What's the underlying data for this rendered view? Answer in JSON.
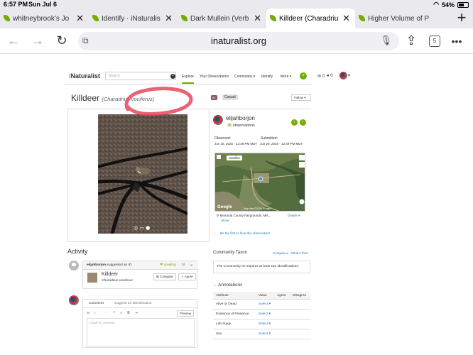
{
  "status": {
    "time": "6:57 PM",
    "date": "Sun Jul 6",
    "battery": "54%",
    "battery_level": 0.54
  },
  "tabs": [
    {
      "label": "whitneybrook's Jo"
    },
    {
      "label": "Identify · iNaturalis"
    },
    {
      "label": "Dark Mullein (Verb"
    },
    {
      "label": "Killdeer (Charadriu"
    },
    {
      "label": "Higher Volume of P"
    }
  ],
  "toolbar": {
    "host": "inaturalist.org",
    "tab_count": "5",
    "new_tab": "+"
  },
  "inat": {
    "logo_i": "i",
    "logo_rest": "Naturalist",
    "search_placeholder": "Search",
    "nav": {
      "explore": "Explore",
      "your_observations": "Your Observations",
      "community": "Community ▾",
      "identify": "Identify",
      "more": "More ▾"
    },
    "messages_count": "0",
    "notifications_count": "0"
  },
  "observation": {
    "common_name": "Killdeer",
    "scientific_name": "(Charadrius vociferus)",
    "id_badge": "ID",
    "quality": "Casual",
    "follow": "Follow ▾",
    "user": "elijahborjon",
    "obs_count": "36",
    "obs_label": " observations",
    "observed_label": "Observed:",
    "observed_value": "Jun 18, 2025 · 12:48 PM MDT",
    "submitted_label": "Submitted:",
    "submitted_value": "Jun 29, 2025 · 12:49 PM MDT",
    "map_type": "Satellite",
    "map_google": "Google",
    "map_attrib": "Map data ©2025 Google",
    "location": "Missoula County Fairgrounds, Mis...",
    "details": "Details ▾",
    "show": "Show",
    "fave": "Be the first to fave this observation!"
  },
  "activity": {
    "title": "Activity",
    "suggester": "elijahborjon",
    "suggested_text": " suggested an ID",
    "leading": "Leading",
    "age": "7d",
    "taxon_common": "Killdeer",
    "taxon_sci": "Charadrius vociferus",
    "compare": "Compare",
    "agree": "✓ Agree",
    "tab_comment": "Comment",
    "tab_suggest": "Suggest an Identification",
    "preview": "Preview",
    "comment_placeholder": "Leave a comment"
  },
  "community": {
    "title": "Community Taxon",
    "compare_link": "Compare ▸",
    "whats_this": "What's this?",
    "message": "The Community ID requires at least two identifications."
  },
  "annotations": {
    "title": "Annotations",
    "headers": {
      "attribute": "Attribute",
      "value": "Value",
      "agree": "Agree",
      "disagree": "Disagree"
    },
    "rows": [
      {
        "attribute": "Alive or Dead",
        "value": "Select ▾"
      },
      {
        "attribute": "Evidence of Presence",
        "value": "Select ▾"
      },
      {
        "attribute": "Life Stage",
        "value": "Select ▾"
      },
      {
        "attribute": "Sex",
        "value": "Select ▾"
      }
    ]
  },
  "colors": {
    "inat_green": "#74ac00",
    "link_blue": "#2a7dbb",
    "annotation_red": "#e8475f"
  }
}
